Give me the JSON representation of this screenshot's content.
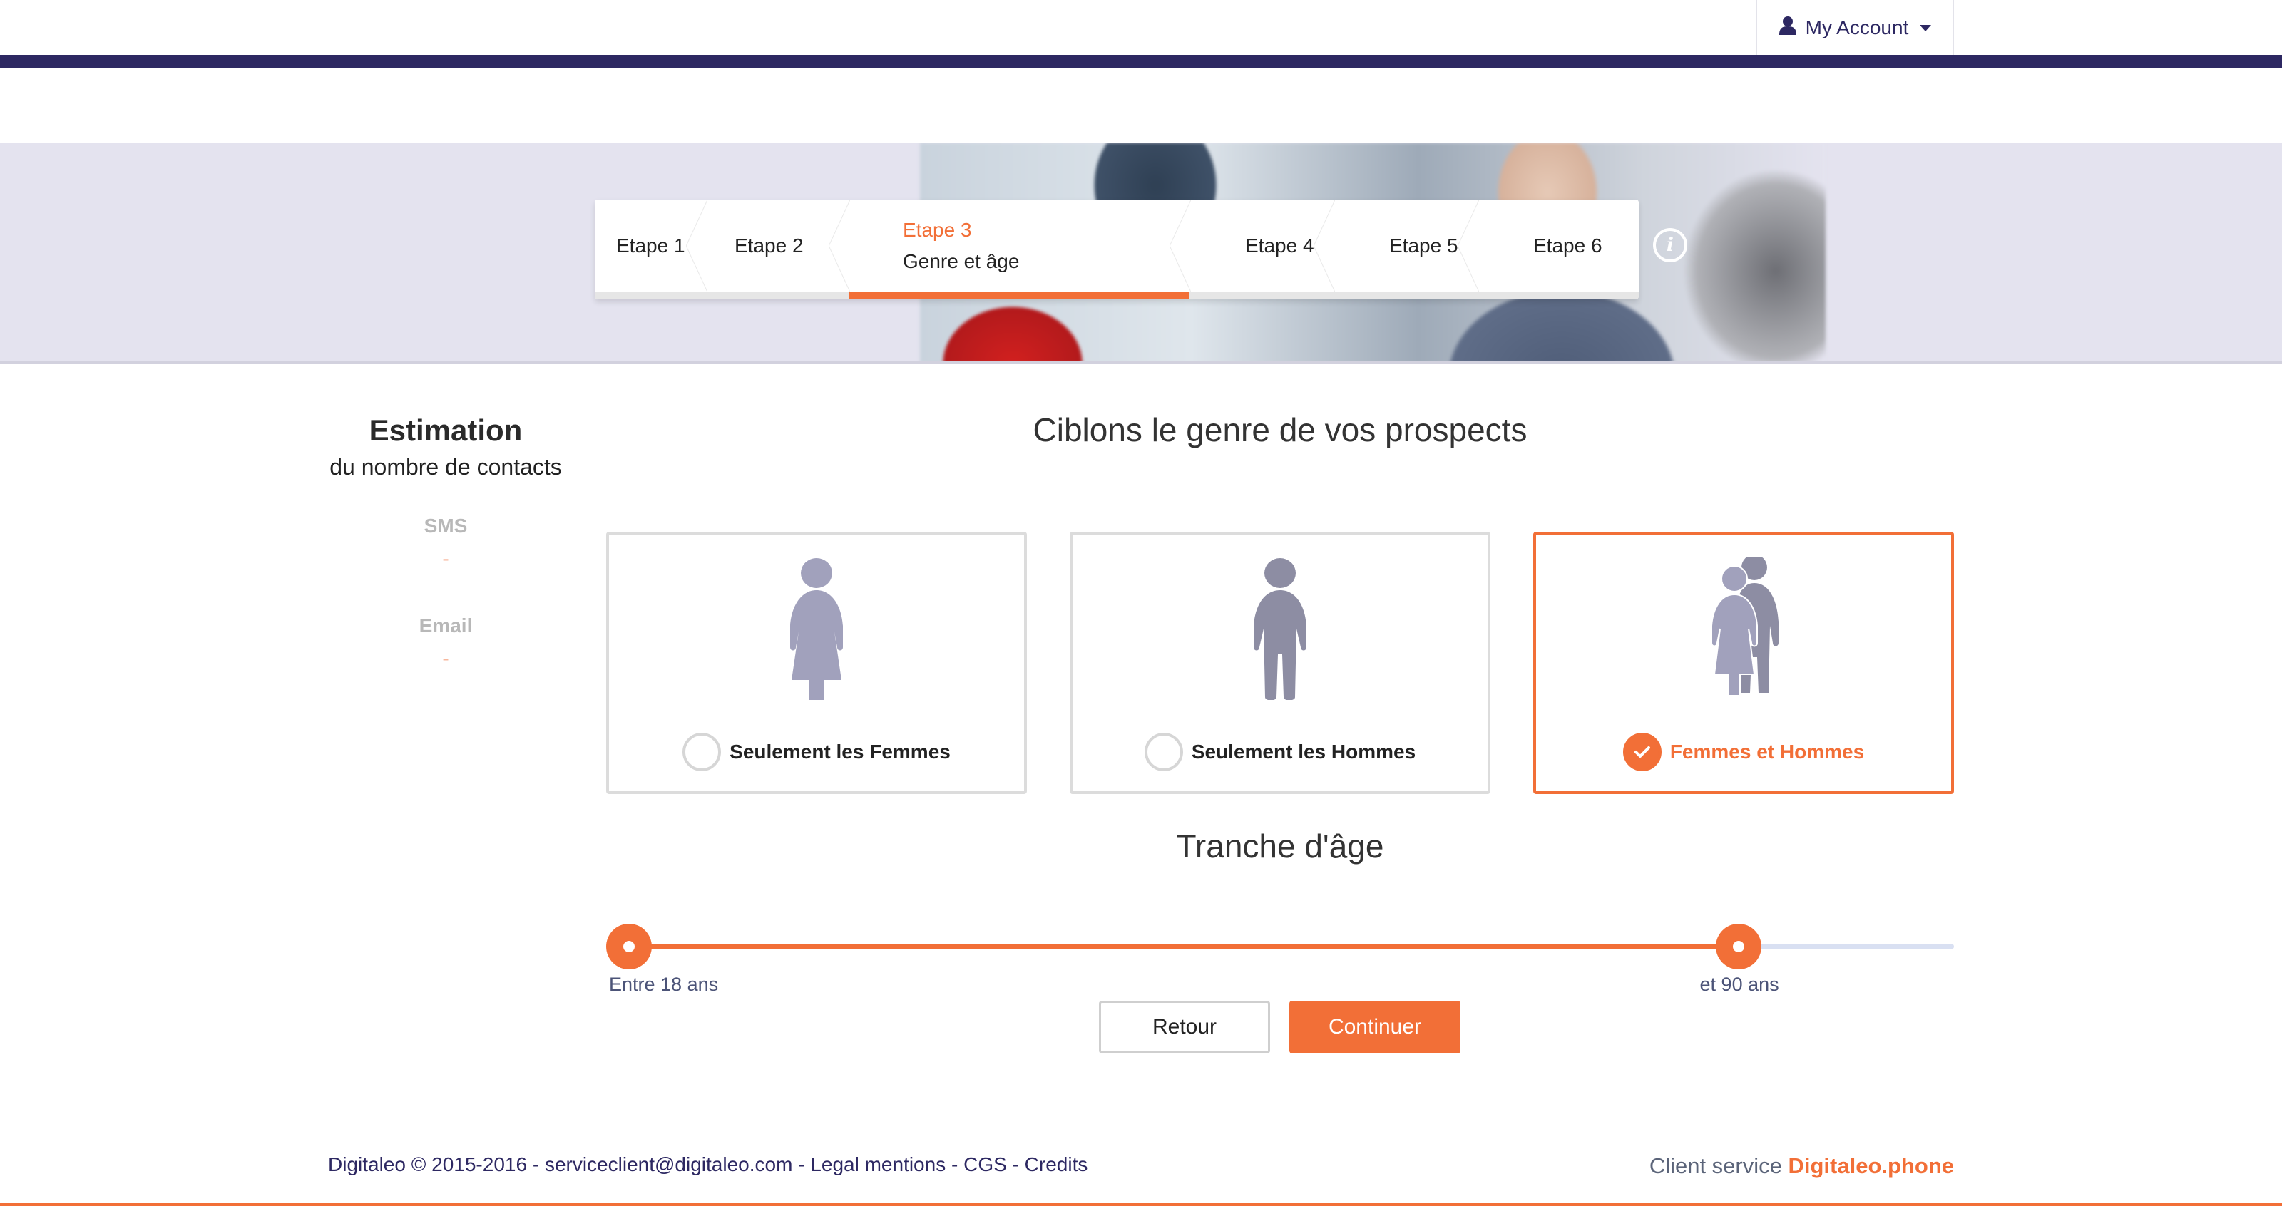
{
  "header": {
    "account_label": "My Account",
    "account_icon": "user-icon",
    "nav_color": "#2d2862"
  },
  "stepper": {
    "steps": [
      {
        "label": "Etape 1",
        "active": false
      },
      {
        "label": "Etape 2",
        "active": false
      },
      {
        "label": "Etape 3",
        "subtitle": "Genre et âge",
        "active": true
      },
      {
        "label": "Etape 4",
        "active": false
      },
      {
        "label": "Etape 5",
        "active": false
      },
      {
        "label": "Etape 6",
        "active": false
      }
    ],
    "info_icon": "info-icon",
    "info_glyph": "i"
  },
  "estimation": {
    "title": "Estimation",
    "subtitle": "du nombre de contacts",
    "channels": [
      {
        "label": "SMS",
        "value": "-"
      },
      {
        "label": "Email",
        "value": "-"
      }
    ]
  },
  "gender": {
    "title": "Ciblons le genre de vos prospects",
    "options": [
      {
        "label": "Seulement les Femmes",
        "icon": "woman-icon",
        "selected": false
      },
      {
        "label": "Seulement les Hommes",
        "icon": "man-icon",
        "selected": false
      },
      {
        "label": "Femmes et Hommes",
        "icon": "couple-icon",
        "selected": true
      }
    ]
  },
  "age": {
    "title": "Tranche d'âge",
    "min": 18,
    "max": 90,
    "range_min": 18,
    "range_max": 104,
    "min_label": "Entre 18 ans",
    "max_label": "et 90 ans"
  },
  "actions": {
    "back_label": "Retour",
    "continue_label": "Continuer"
  },
  "footer": {
    "company": "Digitaleo © 2015-2016",
    "sep": " - ",
    "email": "serviceclient@digitaleo.com",
    "legal": "Legal mentions",
    "cgs": "CGS",
    "credits": "Credits",
    "client_service_label": "Client service",
    "client_service_brand": "Digitaleo.phone"
  },
  "colors": {
    "accent": "#f26f37",
    "primary": "#2d2862",
    "icon_gray": "#a1a1bc"
  }
}
